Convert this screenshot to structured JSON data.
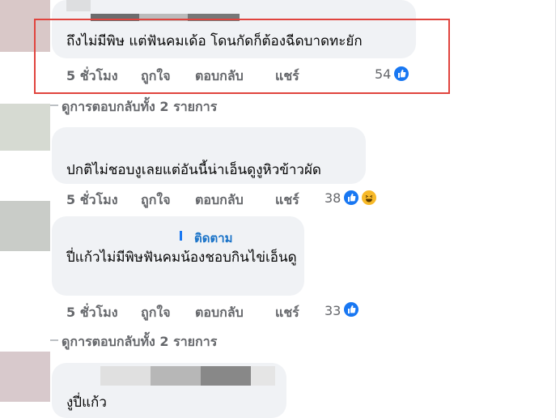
{
  "comments": [
    {
      "text": "ถึงไม่มีพิษ แต่ฟันคมเด้อ โดนกัดก็ต้องฉีดบาดทะยัก",
      "time": "5 ชั่วโมง",
      "like_label": "ถูกใจ",
      "reply_label": "ตอบกลับ",
      "share_label": "แชร์",
      "reaction_count": "54"
    },
    {
      "text": "ปกติไม่ชอบงูเลยแต่อันนี้น่าเอ็นดูงูหิวข้าวผัด",
      "time": "5 ชั่วโมง",
      "like_label": "ถูกใจ",
      "reply_label": "ตอบกลับ",
      "share_label": "แชร์",
      "reaction_count": "38"
    },
    {
      "follow_label": "ติดตาม",
      "text": "ปี่แก้วไม่มีพิษฟันคมน้องชอบกินไข่เอ็นดู",
      "time": "5 ชั่วโมง",
      "like_label": "ถูกใจ",
      "reply_label": "ตอบกลับ",
      "share_label": "แชร์",
      "reaction_count": "33"
    },
    {
      "text": "งูปี่แก้ว"
    }
  ],
  "view_replies": [
    {
      "label": "ดูการตอบกลับทั้ง 2 รายการ"
    },
    {
      "label": "ดูการตอบกลับทั้ง 2 รายการ"
    }
  ],
  "colors": {
    "accent": "#1877f2",
    "highlight_border": "#e0443e",
    "bubble": "#f0f2f5",
    "meta_text": "#65676b"
  }
}
